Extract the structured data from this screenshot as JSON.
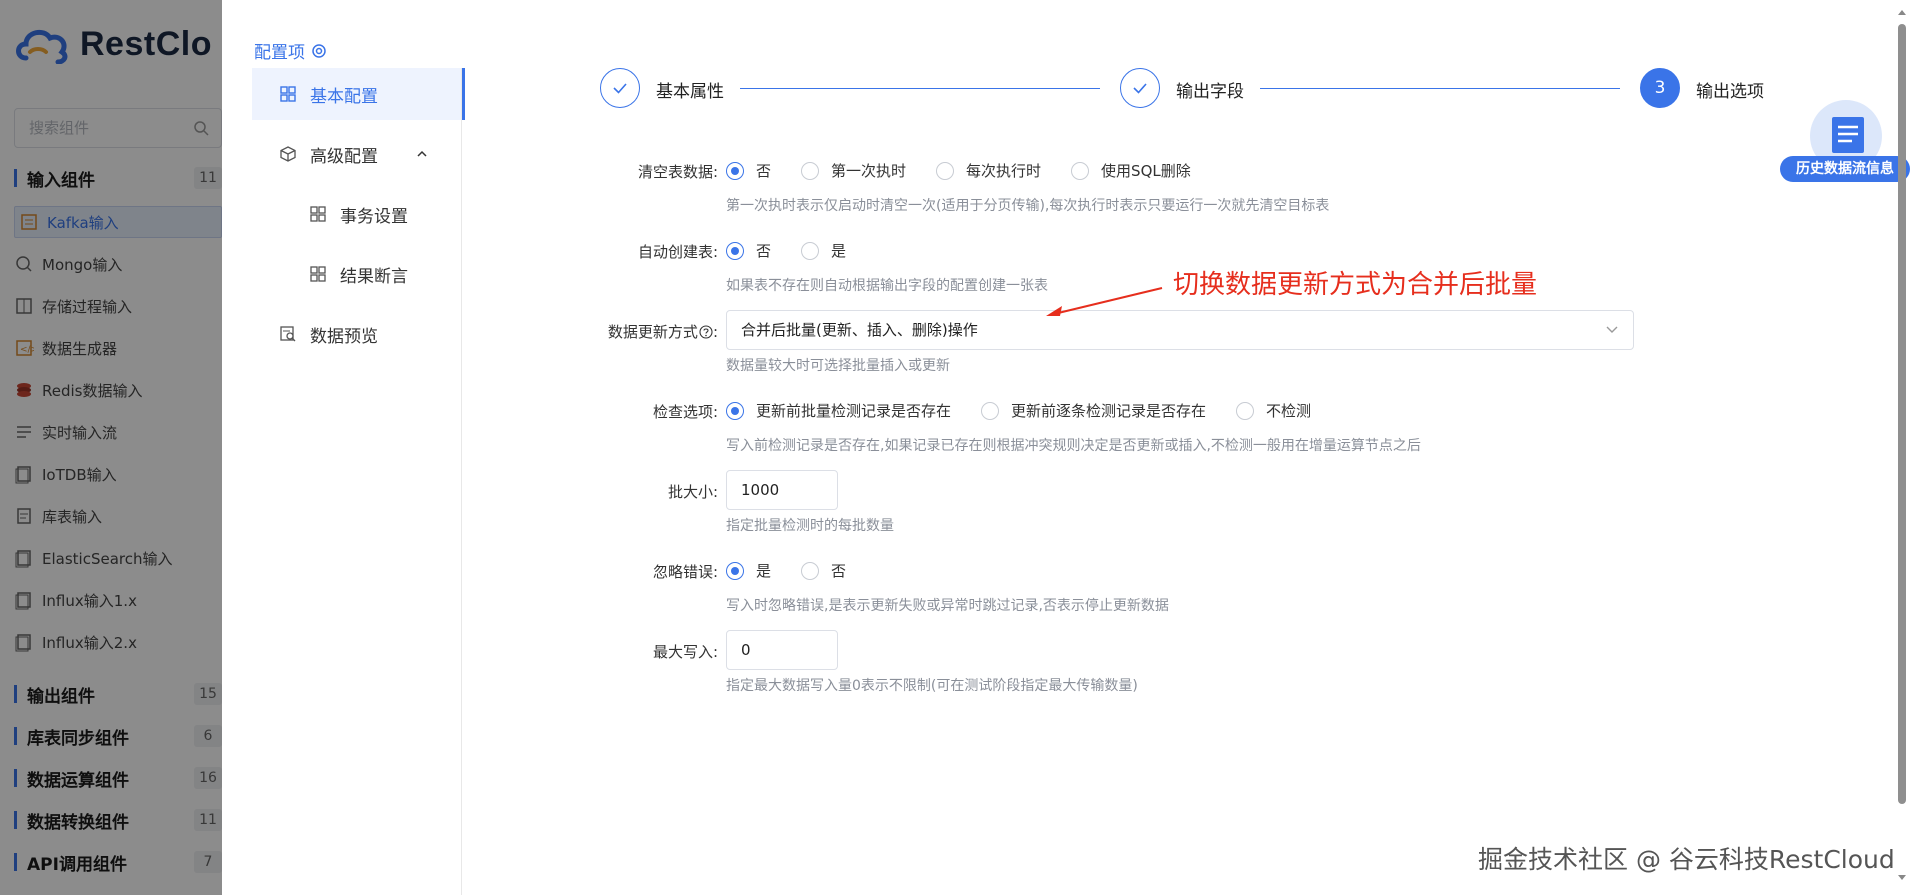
{
  "app": {
    "logo_text": "RestClo",
    "search_placeholder": "搜索组件"
  },
  "sidebar": {
    "categories": [
      {
        "label": "输入组件",
        "count": "11"
      },
      {
        "label": "输出组件",
        "count": "15"
      },
      {
        "label": "库表同步组件",
        "count": "6"
      },
      {
        "label": "数据运算组件",
        "count": "16"
      },
      {
        "label": "数据转换组件",
        "count": "11"
      },
      {
        "label": "API调用组件",
        "count": "7"
      }
    ],
    "input_components": [
      {
        "label": "Kafka输入",
        "icon": "kafka-icon"
      },
      {
        "label": "Mongo输入",
        "icon": "mongo-icon"
      },
      {
        "label": "存储过程输入",
        "icon": "procedure-icon"
      },
      {
        "label": "数据生成器",
        "icon": "generator-icon"
      },
      {
        "label": "Redis数据输入",
        "icon": "redis-icon"
      },
      {
        "label": "实时输入流",
        "icon": "stream-icon"
      },
      {
        "label": "IoTDB输入",
        "icon": "iotdb-icon"
      },
      {
        "label": "库表输入",
        "icon": "table-icon"
      },
      {
        "label": "ElasticSearch输入",
        "icon": "elasticsearch-icon"
      },
      {
        "label": "Influx输入1.x",
        "icon": "influx-icon"
      },
      {
        "label": "Influx输入2.x",
        "icon": "influx-icon"
      }
    ]
  },
  "config": {
    "title": "配置项",
    "nav": {
      "basic": "基本配置",
      "advanced": "高级配置",
      "transaction": "事务设置",
      "assertion": "结果断言",
      "preview": "数据预览"
    }
  },
  "steps": [
    {
      "label": "基本属性",
      "state": "done"
    },
    {
      "label": "输出字段",
      "state": "done"
    },
    {
      "label": "输出选项",
      "state": "current",
      "number": "3"
    }
  ],
  "form": {
    "clear_table": {
      "label": "清空表数据:",
      "options": [
        "否",
        "第一次执时",
        "每次执行时",
        "使用SQL删除"
      ],
      "selected": "否",
      "hint": "第一次执时表示仅启动时清空一次(适用于分页传输),每次执行时表示只要运行一次就先清空目标表"
    },
    "auto_create": {
      "label": "自动创建表:",
      "options": [
        "否",
        "是"
      ],
      "selected": "否",
      "hint": "如果表不存在则自动根据输出字段的配置创建一张表"
    },
    "update_mode": {
      "label": "数据更新方式",
      "label_suffix": ":",
      "value": "合并后批量(更新、插入、删除)操作",
      "hint": "数据量较大时可选择批量插入或更新"
    },
    "check_option": {
      "label": "检查选项:",
      "options": [
        "更新前批量检测记录是否存在",
        "更新前逐条检测记录是否存在",
        "不检测"
      ],
      "selected": "更新前批量检测记录是否存在",
      "hint": "写入前检测记录是否存在,如果记录已存在则根据冲突规则决定是否更新或插入,不检测一般用在增量运算节点之后"
    },
    "batch_size": {
      "label": "批大小:",
      "value": "1000",
      "hint": "指定批量检测时的每批数量"
    },
    "ignore_errors": {
      "label": "忽略错误:",
      "options": [
        "是",
        "否"
      ],
      "selected": "是",
      "hint": "写入时忽略错误,是表示更新失败或异常时跳过记录,否表示停止更新数据"
    },
    "max_write": {
      "label": "最大写入:",
      "value": "0",
      "hint": "指定最大数据写入量0表示不限制(可在测试阶段指定最大传输数量)"
    }
  },
  "annotation": "切换数据更新方式为合并后批量",
  "history_button": "历史数据流信息",
  "watermark": "掘金技术社区 @ 谷云科技RestCloud",
  "colors": {
    "accent": "#3a74e8",
    "annotation": "#e62e1d",
    "hint": "#8a8f99"
  }
}
